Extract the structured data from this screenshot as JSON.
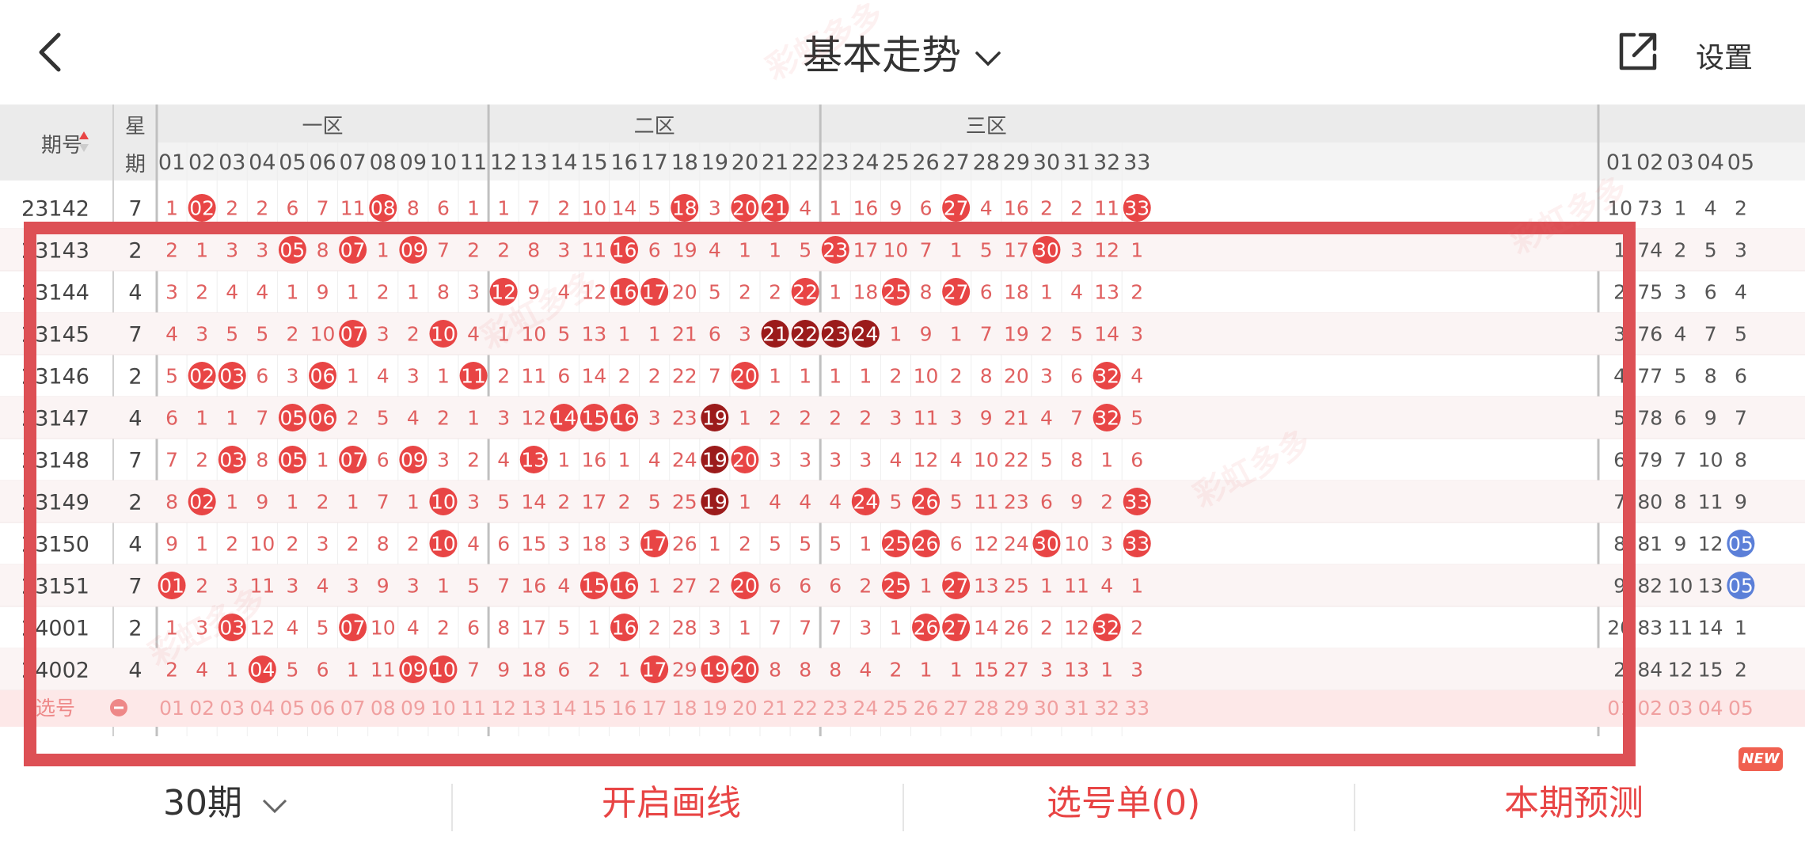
{
  "header": {
    "title": "基本走势",
    "settings_label": "设置"
  },
  "table": {
    "col_period": "期号",
    "col_week": [
      "星",
      "期"
    ],
    "zones": [
      "一区",
      "二区",
      "三区"
    ],
    "main_numbers": [
      "01",
      "02",
      "03",
      "04",
      "05",
      "06",
      "07",
      "08",
      "09",
      "10",
      "11",
      "12",
      "13",
      "14",
      "15",
      "16",
      "17",
      "18",
      "19",
      "20",
      "21",
      "22",
      "23",
      "24",
      "25",
      "26",
      "27",
      "28",
      "29",
      "30",
      "31",
      "32",
      "33"
    ],
    "extra_numbers": [
      "01",
      "02",
      "03",
      "04",
      "05"
    ],
    "rows": [
      {
        "period": "23142",
        "week": "7",
        "vals": [
          "1",
          "02",
          "2",
          "2",
          "6",
          "7",
          "11",
          "08",
          "8",
          "6",
          "1",
          "1",
          "7",
          "2",
          "10",
          "14",
          "5",
          "18",
          "3",
          "20",
          "21",
          "4",
          "1",
          "16",
          "9",
          "6",
          "27",
          "4",
          "16",
          "2",
          "2",
          "11",
          "33"
        ],
        "extra": [
          "10",
          "73",
          "1",
          "4",
          "2"
        ]
      },
      {
        "period": "23143",
        "week": "2",
        "vals": [
          "2",
          "1",
          "3",
          "3",
          "05",
          "8",
          "07",
          "1",
          "09",
          "7",
          "2",
          "2",
          "8",
          "3",
          "11",
          "16",
          "6",
          "19",
          "4",
          "1",
          "1",
          "5",
          "23",
          "17",
          "10",
          "7",
          "1",
          "5",
          "17",
          "30",
          "3",
          "12",
          "1"
        ],
        "extra": [
          "1",
          "74",
          "2",
          "5",
          "3"
        ]
      },
      {
        "period": "23144",
        "week": "4",
        "vals": [
          "3",
          "2",
          "4",
          "4",
          "1",
          "9",
          "1",
          "2",
          "1",
          "8",
          "3",
          "12",
          "9",
          "4",
          "12",
          "16",
          "17",
          "20",
          "5",
          "2",
          "2",
          "22",
          "1",
          "18",
          "25",
          "8",
          "27",
          "6",
          "18",
          "1",
          "4",
          "13",
          "2"
        ],
        "extra": [
          "2",
          "75",
          "3",
          "6",
          "4"
        ]
      },
      {
        "period": "23145",
        "week": "7",
        "vals": [
          "4",
          "3",
          "5",
          "5",
          "2",
          "10",
          "07",
          "3",
          "2",
          "10",
          "4",
          "1",
          "10",
          "5",
          "13",
          "1",
          "1",
          "21",
          "6",
          "3",
          "21",
          "22",
          "23",
          "24",
          "1",
          "9",
          "1",
          "7",
          "19",
          "2",
          "5",
          "14",
          "3"
        ],
        "extra": [
          "3",
          "76",
          "4",
          "7",
          "5"
        ]
      },
      {
        "period": "23146",
        "week": "2",
        "vals": [
          "5",
          "02",
          "03",
          "6",
          "3",
          "06",
          "1",
          "4",
          "3",
          "1",
          "11",
          "2",
          "11",
          "6",
          "14",
          "2",
          "2",
          "22",
          "7",
          "20",
          "1",
          "1",
          "1",
          "1",
          "2",
          "10",
          "2",
          "8",
          "20",
          "3",
          "6",
          "32",
          "4"
        ],
        "extra": [
          "4",
          "77",
          "5",
          "8",
          "6"
        ]
      },
      {
        "period": "23147",
        "week": "4",
        "vals": [
          "6",
          "1",
          "1",
          "7",
          "05",
          "06",
          "2",
          "5",
          "4",
          "2",
          "1",
          "3",
          "12",
          "14",
          "15",
          "16",
          "3",
          "23",
          "19",
          "1",
          "2",
          "2",
          "2",
          "2",
          "3",
          "11",
          "3",
          "9",
          "21",
          "4",
          "7",
          "32",
          "5"
        ],
        "extra": [
          "5",
          "78",
          "6",
          "9",
          "7"
        ]
      },
      {
        "period": "23148",
        "week": "7",
        "vals": [
          "7",
          "2",
          "03",
          "8",
          "05",
          "1",
          "07",
          "6",
          "09",
          "3",
          "2",
          "4",
          "13",
          "1",
          "16",
          "1",
          "4",
          "24",
          "19",
          "20",
          "3",
          "3",
          "3",
          "3",
          "4",
          "12",
          "4",
          "10",
          "22",
          "5",
          "8",
          "1",
          "6"
        ],
        "extra": [
          "6",
          "79",
          "7",
          "10",
          "8"
        ]
      },
      {
        "period": "23149",
        "week": "2",
        "vals": [
          "8",
          "02",
          "1",
          "9",
          "1",
          "2",
          "1",
          "7",
          "1",
          "10",
          "3",
          "5",
          "14",
          "2",
          "17",
          "2",
          "5",
          "25",
          "19",
          "1",
          "4",
          "4",
          "4",
          "24",
          "5",
          "26",
          "5",
          "11",
          "23",
          "6",
          "9",
          "2",
          "33"
        ],
        "extra": [
          "7",
          "80",
          "8",
          "11",
          "9"
        ]
      },
      {
        "period": "23150",
        "week": "4",
        "vals": [
          "9",
          "1",
          "2",
          "10",
          "2",
          "3",
          "2",
          "8",
          "2",
          "10",
          "4",
          "6",
          "15",
          "3",
          "18",
          "3",
          "17",
          "26",
          "1",
          "2",
          "5",
          "5",
          "5",
          "1",
          "25",
          "26",
          "6",
          "12",
          "24",
          "30",
          "10",
          "3",
          "33"
        ],
        "extra": [
          "8",
          "81",
          "9",
          "12",
          "05"
        ]
      },
      {
        "period": "23151",
        "week": "7",
        "vals": [
          "01",
          "2",
          "3",
          "11",
          "3",
          "4",
          "3",
          "9",
          "3",
          "1",
          "5",
          "7",
          "16",
          "4",
          "15",
          "16",
          "1",
          "27",
          "2",
          "20",
          "6",
          "6",
          "6",
          "2",
          "25",
          "1",
          "27",
          "13",
          "25",
          "1",
          "11",
          "4",
          "1"
        ],
        "extra": [
          "9",
          "82",
          "10",
          "13",
          "05"
        ]
      },
      {
        "period": "24001",
        "week": "2",
        "vals": [
          "1",
          "3",
          "03",
          "12",
          "4",
          "5",
          "07",
          "10",
          "4",
          "2",
          "6",
          "8",
          "17",
          "5",
          "1",
          "16",
          "2",
          "28",
          "3",
          "1",
          "7",
          "7",
          "7",
          "3",
          "1",
          "26",
          "27",
          "14",
          "26",
          "2",
          "12",
          "32",
          "2"
        ],
        "extra": [
          "20",
          "83",
          "11",
          "14",
          "1"
        ]
      },
      {
        "period": "24002",
        "week": "4",
        "vals": [
          "2",
          "4",
          "1",
          "04",
          "5",
          "6",
          "1",
          "11",
          "09",
          "10",
          "7",
          "9",
          "18",
          "6",
          "2",
          "1",
          "17",
          "29",
          "19",
          "20",
          "8",
          "8",
          "8",
          "4",
          "2",
          "1",
          "1",
          "15",
          "27",
          "3",
          "13",
          "1",
          "3"
        ],
        "extra": [
          "2",
          "84",
          "12",
          "15",
          "2"
        ]
      }
    ],
    "select_label": "选号"
  },
  "bottom": {
    "period_label": "30期",
    "draw_line": "开启画线",
    "pick_list": "选号单(0)",
    "predict": "本期预测",
    "new_badge": "NEW"
  },
  "colors": {
    "accent": "#e84545",
    "dark_ball": "#9b1b1b",
    "blue_ball": "#5b7fd8"
  },
  "watermark_text": "彩虹多多"
}
